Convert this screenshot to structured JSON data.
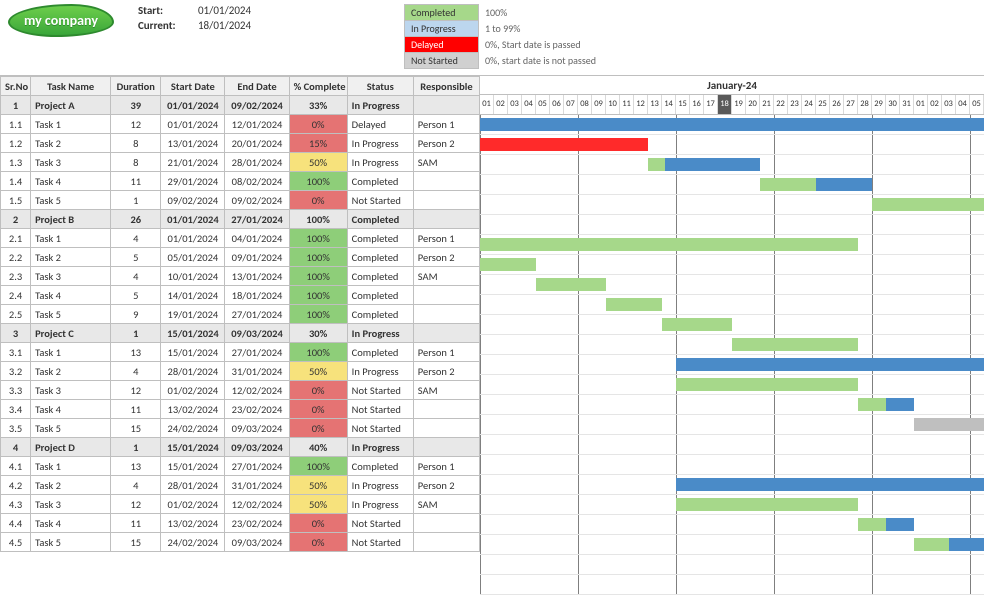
{
  "logo_text": "my company",
  "meta": {
    "start_label": "Start:",
    "start_value": "01/01/2024",
    "current_label": "Current:",
    "current_value": "18/01/2024"
  },
  "legend": {
    "items": [
      {
        "label": "Completed",
        "desc": "100%",
        "class": "sw-green"
      },
      {
        "label": "In Progress",
        "desc": "1 to 99%",
        "class": "sw-blue"
      },
      {
        "label": "Delayed",
        "desc": "0%, Start date is passed",
        "class": "sw-red"
      },
      {
        "label": "Not Started",
        "desc": "0%, start date is not passed",
        "class": "sw-grey"
      }
    ]
  },
  "columns": {
    "sr": "Sr.No",
    "name": "Task Name",
    "dur": "Duration",
    "sd": "Start Date",
    "ed": "End Date",
    "pct": "% Complete",
    "stat": "Status",
    "resp": "Responsible"
  },
  "timeline": {
    "month_label": "January-24",
    "start_day_offset": 0,
    "today_index": 17,
    "days": [
      "01",
      "02",
      "03",
      "04",
      "05",
      "06",
      "07",
      "08",
      "09",
      "10",
      "11",
      "12",
      "13",
      "14",
      "15",
      "16",
      "17",
      "18",
      "19",
      "20",
      "21",
      "22",
      "23",
      "24",
      "25",
      "26",
      "27",
      "28",
      "29",
      "30",
      "31",
      "01",
      "02",
      "03",
      "04",
      "05"
    ]
  },
  "chart_data": {
    "type": "gantt",
    "unit": "days",
    "timeline_start": "01/01/2024",
    "timeline_days": 36,
    "current_day_index": 17,
    "status_colors": {
      "Completed": "#a6d88a",
      "In Progress": "#4a8bc8",
      "Delayed": "#ff2a2a",
      "Not Started": "#bfbfbf"
    },
    "rows": [
      {
        "sr": "1",
        "name": "Project A",
        "dur": 39,
        "sd": "01/01/2024",
        "ed": "09/02/2024",
        "pct": "33%",
        "pct_class": "cell-orange",
        "stat": "In Progress",
        "resp": "",
        "proj": true,
        "bars": [
          {
            "start": 0,
            "len": 36,
            "color": "bar-blue"
          }
        ]
      },
      {
        "sr": "1.1",
        "name": "Task 1",
        "dur": 12,
        "sd": "01/01/2024",
        "ed": "12/01/2024",
        "pct": "0%",
        "pct_class": "cell-red",
        "stat": "Delayed",
        "resp": "Person 1",
        "bars": [
          {
            "start": 0,
            "len": 12,
            "color": "bar-red"
          }
        ]
      },
      {
        "sr": "1.2",
        "name": "Task 2",
        "dur": 8,
        "sd": "13/01/2024",
        "ed": "20/01/2024",
        "pct": "15%",
        "pct_class": "cell-red",
        "stat": "In Progress",
        "resp": "Person 2",
        "bars": [
          {
            "start": 12,
            "len": 1.2,
            "color": "bar-green"
          },
          {
            "start": 13.2,
            "len": 6.8,
            "color": "bar-blue"
          }
        ]
      },
      {
        "sr": "1.3",
        "name": "Task 3",
        "dur": 8,
        "sd": "21/01/2024",
        "ed": "28/01/2024",
        "pct": "50%",
        "pct_class": "cell-yellow",
        "stat": "In Progress",
        "resp": "SAM",
        "bars": [
          {
            "start": 20,
            "len": 4,
            "color": "bar-green"
          },
          {
            "start": 24,
            "len": 4,
            "color": "bar-blue"
          }
        ]
      },
      {
        "sr": "1.4",
        "name": "Task 4",
        "dur": 11,
        "sd": "29/01/2024",
        "ed": "08/02/2024",
        "pct": "100%",
        "pct_class": "cell-green",
        "stat": "Completed",
        "resp": "",
        "bars": [
          {
            "start": 28,
            "len": 8,
            "color": "bar-green"
          }
        ]
      },
      {
        "sr": "1.5",
        "name": "Task 5",
        "dur": 1,
        "sd": "09/02/2024",
        "ed": "09/02/2024",
        "pct": "0%",
        "pct_class": "cell-red",
        "stat": "Not Started",
        "resp": "",
        "bars": []
      },
      {
        "sr": "2",
        "name": "Project B",
        "dur": 26,
        "sd": "01/01/2024",
        "ed": "27/01/2024",
        "pct": "100%",
        "pct_class": "cell-green",
        "stat": "Completed",
        "resp": "",
        "proj": true,
        "bars": [
          {
            "start": 0,
            "len": 27,
            "color": "bar-green"
          }
        ]
      },
      {
        "sr": "2.1",
        "name": "Task 1",
        "dur": 4,
        "sd": "01/01/2024",
        "ed": "04/01/2024",
        "pct": "100%",
        "pct_class": "cell-green",
        "stat": "Completed",
        "resp": "Person 1",
        "bars": [
          {
            "start": 0,
            "len": 4,
            "color": "bar-green"
          }
        ]
      },
      {
        "sr": "2.2",
        "name": "Task 2",
        "dur": 5,
        "sd": "05/01/2024",
        "ed": "09/01/2024",
        "pct": "100%",
        "pct_class": "cell-green",
        "stat": "Completed",
        "resp": "Person 2",
        "bars": [
          {
            "start": 4,
            "len": 5,
            "color": "bar-green"
          }
        ]
      },
      {
        "sr": "2.3",
        "name": "Task 3",
        "dur": 4,
        "sd": "10/01/2024",
        "ed": "13/01/2024",
        "pct": "100%",
        "pct_class": "cell-green",
        "stat": "Completed",
        "resp": "SAM",
        "bars": [
          {
            "start": 9,
            "len": 4,
            "color": "bar-green"
          }
        ]
      },
      {
        "sr": "2.4",
        "name": "Task 4",
        "dur": 5,
        "sd": "14/01/2024",
        "ed": "18/01/2024",
        "pct": "100%",
        "pct_class": "cell-green",
        "stat": "Completed",
        "resp": "",
        "bars": [
          {
            "start": 13,
            "len": 5,
            "color": "bar-green"
          }
        ]
      },
      {
        "sr": "2.5",
        "name": "Task 5",
        "dur": 9,
        "sd": "19/01/2024",
        "ed": "27/01/2024",
        "pct": "100%",
        "pct_class": "cell-green",
        "stat": "Completed",
        "resp": "",
        "bars": [
          {
            "start": 18,
            "len": 9,
            "color": "bar-green"
          }
        ]
      },
      {
        "sr": "3",
        "name": "Project C",
        "dur": 1,
        "sd": "15/01/2024",
        "ed": "09/03/2024",
        "pct": "30%",
        "pct_class": "cell-orange",
        "stat": "In Progress",
        "resp": "",
        "proj": true,
        "bars": [
          {
            "start": 14,
            "len": 22,
            "color": "bar-blue"
          }
        ]
      },
      {
        "sr": "3.1",
        "name": "Task 1",
        "dur": 13,
        "sd": "15/01/2024",
        "ed": "27/01/2024",
        "pct": "100%",
        "pct_class": "cell-green",
        "stat": "Completed",
        "resp": "Person 1",
        "bars": [
          {
            "start": 14,
            "len": 13,
            "color": "bar-green"
          }
        ]
      },
      {
        "sr": "3.2",
        "name": "Task 2",
        "dur": 4,
        "sd": "28/01/2024",
        "ed": "31/01/2024",
        "pct": "50%",
        "pct_class": "cell-yellow",
        "stat": "In Progress",
        "resp": "Person 2",
        "bars": [
          {
            "start": 27,
            "len": 2,
            "color": "bar-green"
          },
          {
            "start": 29,
            "len": 2,
            "color": "bar-blue"
          }
        ]
      },
      {
        "sr": "3.3",
        "name": "Task 3",
        "dur": 12,
        "sd": "01/02/2024",
        "ed": "12/02/2024",
        "pct": "0%",
        "pct_class": "cell-red",
        "stat": "Not Started",
        "resp": "SAM",
        "bars": [
          {
            "start": 31,
            "len": 5,
            "color": "bar-grey"
          }
        ]
      },
      {
        "sr": "3.4",
        "name": "Task 4",
        "dur": 11,
        "sd": "13/02/2024",
        "ed": "23/02/2024",
        "pct": "0%",
        "pct_class": "cell-red",
        "stat": "Not Started",
        "resp": "",
        "bars": []
      },
      {
        "sr": "3.5",
        "name": "Task 5",
        "dur": 15,
        "sd": "24/02/2024",
        "ed": "09/03/2024",
        "pct": "0%",
        "pct_class": "cell-red",
        "stat": "Not Started",
        "resp": "",
        "bars": []
      },
      {
        "sr": "4",
        "name": "Project D",
        "dur": 1,
        "sd": "15/01/2024",
        "ed": "09/03/2024",
        "pct": "40%",
        "pct_class": "cell-orange",
        "stat": "In Progress",
        "resp": "",
        "proj": true,
        "bars": [
          {
            "start": 14,
            "len": 22,
            "color": "bar-blue"
          }
        ]
      },
      {
        "sr": "4.1",
        "name": "Task 1",
        "dur": 13,
        "sd": "15/01/2024",
        "ed": "27/01/2024",
        "pct": "100%",
        "pct_class": "cell-green",
        "stat": "Completed",
        "resp": "Person 1",
        "bars": [
          {
            "start": 14,
            "len": 13,
            "color": "bar-green"
          }
        ]
      },
      {
        "sr": "4.2",
        "name": "Task 2",
        "dur": 4,
        "sd": "28/01/2024",
        "ed": "31/01/2024",
        "pct": "50%",
        "pct_class": "cell-yellow",
        "stat": "In Progress",
        "resp": "Person 2",
        "bars": [
          {
            "start": 27,
            "len": 2,
            "color": "bar-green"
          },
          {
            "start": 29,
            "len": 2,
            "color": "bar-blue"
          }
        ]
      },
      {
        "sr": "4.3",
        "name": "Task 3",
        "dur": 12,
        "sd": "01/02/2024",
        "ed": "12/02/2024",
        "pct": "50%",
        "pct_class": "cell-yellow",
        "stat": "In Progress",
        "resp": "SAM",
        "bars": [
          {
            "start": 31,
            "len": 2.5,
            "color": "bar-green"
          },
          {
            "start": 33.5,
            "len": 2.5,
            "color": "bar-blue"
          }
        ]
      },
      {
        "sr": "4.4",
        "name": "Task 4",
        "dur": 11,
        "sd": "13/02/2024",
        "ed": "23/02/2024",
        "pct": "0%",
        "pct_class": "cell-red",
        "stat": "Not Started",
        "resp": "",
        "bars": []
      },
      {
        "sr": "4.5",
        "name": "Task 5",
        "dur": 15,
        "sd": "24/02/2024",
        "ed": "09/03/2024",
        "pct": "0%",
        "pct_class": "cell-red",
        "stat": "Not Started",
        "resp": "",
        "bars": []
      }
    ]
  }
}
